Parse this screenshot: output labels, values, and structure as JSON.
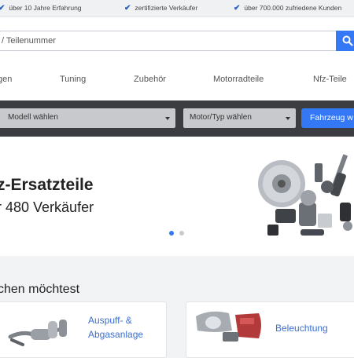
{
  "trust_bar": {
    "items": [
      {
        "icon": "check-icon",
        "text": "über 10 Jahre Erfahrung"
      },
      {
        "icon": "check-icon",
        "text": "zertifizierte Verkäufer"
      },
      {
        "icon": "check-icon",
        "text": "über 700.000 zufriedene Kunden"
      }
    ]
  },
  "search": {
    "placeholder": "/ Teilenummer",
    "button_icon": "search-icon"
  },
  "categories": [
    "gen",
    "Tuning",
    "Zubehör",
    "Motorradteile",
    "Nfz-Teile"
  ],
  "vehicle_selector": {
    "model_label": "Modell wählen",
    "engine_label": "Motor/Typ wählen",
    "button_label": "Fahrzeug w"
  },
  "hero": {
    "title": "z-Ersatzteile",
    "subtitle": "r 480 Verkäufer",
    "image_icon": "car-parts-illustration",
    "slides_total": 2,
    "slide_active": 1
  },
  "lower": {
    "heading": "chen möchtest",
    "cards": [
      {
        "label_line1": "Auspuff- &",
        "label_line2": "Abgasanlage",
        "icon": "exhaust-icon"
      },
      {
        "label_line1": "Beleuchtung",
        "label_line2": "",
        "icon": "headlight-icon"
      }
    ]
  },
  "colors": {
    "accent": "#3478f6",
    "dark_bar": "#3c3d41",
    "link": "#3a6fd0"
  }
}
